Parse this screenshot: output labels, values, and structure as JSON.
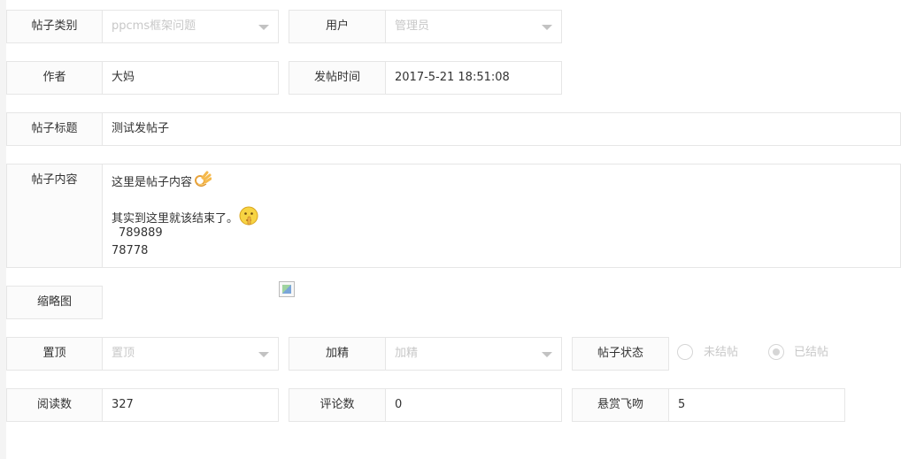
{
  "form": {
    "category": {
      "label": "帖子类别",
      "value": "ppcms框架问题"
    },
    "user": {
      "label": "用户",
      "value": "管理员"
    },
    "author": {
      "label": "作者",
      "value": "大妈"
    },
    "post_time": {
      "label": "发帖时间",
      "value": "2017-5-21 18:51:08"
    },
    "title": {
      "label": "帖子标题",
      "value": "测试发帖子"
    },
    "content": {
      "label": "帖子内容",
      "line1": "这里是帖子内容",
      "line1_emoji": "ok-hand-emoji",
      "line2": "其实到这里就该结束了。",
      "line2_emoji": "shushing-face-emoji",
      "line3": "789889",
      "line4": "78778"
    },
    "thumbnail": {
      "label": "缩略图",
      "image_icon": "broken-image-icon"
    },
    "pin": {
      "label": "置顶",
      "value": "置顶"
    },
    "featured": {
      "label": "加精",
      "value": "加精"
    },
    "status": {
      "label": "帖子状态",
      "options": [
        {
          "label": "未结帖",
          "checked": false
        },
        {
          "label": "已结帖",
          "checked": true
        }
      ]
    },
    "reads": {
      "label": "阅读数",
      "value": "327"
    },
    "comments": {
      "label": "评论数",
      "value": "0"
    },
    "reward": {
      "label": "悬赏飞吻",
      "value": "5"
    }
  },
  "colors": {
    "border": "#e6e6e6",
    "label_bg": "#fbfbfb",
    "disabled_text": "#c8c8c8"
  }
}
